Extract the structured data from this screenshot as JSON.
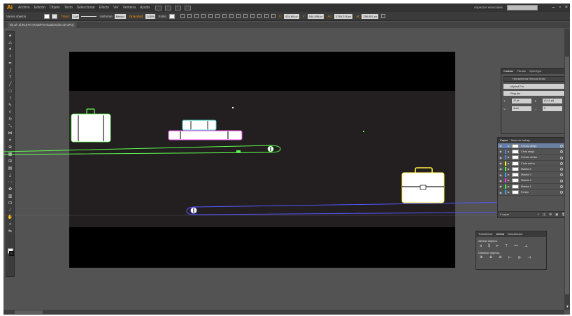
{
  "app": {
    "logo": "Ai"
  },
  "menu": [
    "Archivo",
    "Edición",
    "Objeto",
    "Texto",
    "Seleccionar",
    "Efecto",
    "Ver",
    "Ventana",
    "Ayuda"
  ],
  "workspace": "Aspectos esenciales",
  "control_bar": {
    "selection_label": "Varios objetos",
    "trazo_label": "Trazo:",
    "stroke_weight": "1 pt",
    "stroke_profile": "Uniforme",
    "brush": "Básico",
    "opacity_label": "Opacidad:",
    "opacity_value": "100%",
    "style_label": "Estilo:",
    "x_label": "X:",
    "x_value": "424,69 px",
    "y_label": "Y:",
    "y_value": "544,456 px",
    "w_label": "An:",
    "w_value": "1760,216 px",
    "h_label": "Al:",
    "h_value": "256,851 px"
  },
  "document": {
    "tab_title": "sin.ai* al 96,87% (RGB/Previsualización de GPU)"
  },
  "character_panel": {
    "tabs": [
      "Carácter",
      "Párrafo",
      "OpenType"
    ],
    "touch_type": "Herramienta Retocar texto",
    "font_family": "Myriad Pro",
    "font_style": "Regular",
    "size": "12 pt",
    "leading": "(14,4 pt)",
    "kerning": "Auto",
    "tracking": "0"
  },
  "layers_panel": {
    "tabs": [
      "Capas",
      "Mesa de trabajo"
    ],
    "layers": [
      {
        "name": "Círculo abajo",
        "color": "#4f7fff"
      },
      {
        "name": "Cinta abajo",
        "color": "#4f7fff"
      },
      {
        "name": "Círculo arriba",
        "color": "#4f7fff"
      },
      {
        "name": "Cinta arriba",
        "color": "#ffff00"
      },
      {
        "name": "Maleta 4",
        "color": "#33ff33"
      },
      {
        "name": "Maleta 3",
        "color": "#33aaff"
      },
      {
        "name": "Maleta 2",
        "color": "#ff33ff"
      },
      {
        "name": "Maleta 1",
        "color": "#33ff33"
      },
      {
        "name": "Fondo",
        "color": "#33aaff"
      }
    ],
    "count_label": "9 capas"
  },
  "align_panel": {
    "tabs": [
      "Transformar",
      "Alinear",
      "Buscatrazos"
    ],
    "align_objects_label": "Alinear objetos:",
    "distribute_objects_label": "Distribuir objetos:"
  },
  "colors": {
    "app_bg": "#535353",
    "artboard": "#000000",
    "art_band": "#231f20",
    "suitcase_1": "#5dff4d",
    "suitcase_2": "#e54ce0",
    "suitcase_3": "#4ad6d6",
    "suitcase_4": "#fff13d",
    "belt_top": "#5dff4d",
    "belt_bottom": "#5555ff"
  }
}
